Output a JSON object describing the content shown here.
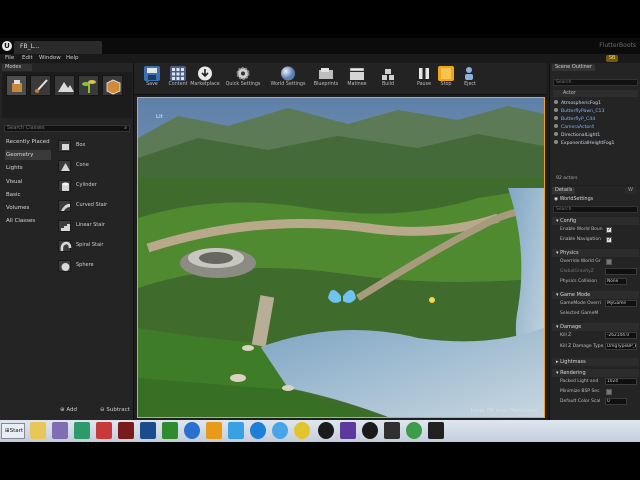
{
  "window": {
    "doc_tab": "FB_L...",
    "brand": "FlutterBoots",
    "menu": [
      "File",
      "Edit",
      "Window",
      "Help"
    ],
    "badge": "SB"
  },
  "modes": {
    "tab_label": "Modes",
    "search_placeholder": "Search Classes",
    "categories": [
      "Recently Placed",
      "Geometry",
      "Lights",
      "Visual",
      "Basic",
      "Volumes",
      "All Classes"
    ],
    "shapes": [
      "Box",
      "Cone",
      "Cylinder",
      "Curved Stair",
      "Linear Stair",
      "Spiral Stair",
      "Sphere"
    ],
    "add_label": "Add",
    "subtract_label": "Subtract"
  },
  "toolbar": {
    "items": [
      "Save",
      "Content",
      "Marketplace",
      "Quick Settings",
      "World Settings",
      "Blueprints",
      "Matinee",
      "Build",
      "Pause",
      "Stop",
      "Eject"
    ],
    "highlighted": "Stop"
  },
  "viewport": {
    "label": "Lit",
    "level": "Level: FB_level (Persistent)"
  },
  "outliner": {
    "tab_label": "Scene Outliner",
    "search_placeholder": "Search",
    "column": "Actor",
    "rows": [
      "AtmosphericFog1",
      "ButterflyPawn_C13",
      "ButterflyP_C44",
      "CameraActor4",
      "DirectionalLight1",
      "ExponentialHeightFog1"
    ],
    "count": "92 actors"
  },
  "details": {
    "tab_label": "Details",
    "tab2_label": "W",
    "object_name": "WorldSettings",
    "search_placeholder": "Search",
    "sections": {
      "config": "Config",
      "physics": "Physics",
      "game_mode": "Game Mode",
      "damage": "Damage",
      "lightmass": "Lightmass",
      "rendering": "Rendering"
    },
    "props": {
      "enable_world_bounds": "Enable World Boun",
      "enable_navigation": "Enable Navigation",
      "override_world_gravity": "Override World Gr",
      "global_gravity": "GlobalGravityZ",
      "physics_collision": "Physics Collision",
      "physics_collision_val": "None",
      "gamemode_override": "GameMode Overri",
      "gamemode_override_val": "MyGame",
      "selected_gamemode": "Selected GameM",
      "kill_z": "Kill Z",
      "kill_z_val": "-262144.0",
      "kill_z_damage": "Kill Z Damage Type",
      "kill_z_damage_val": "DmgTypeBP_Env",
      "packed_light": "Packed Light and",
      "packed_light_val": "1024",
      "minimize_bsp": "Minimize BSP Sec",
      "default_color_scale": "Default Color Scal",
      "default_color_scale_val": "0"
    }
  },
  "taskbar": {
    "start_label": "Start"
  }
}
